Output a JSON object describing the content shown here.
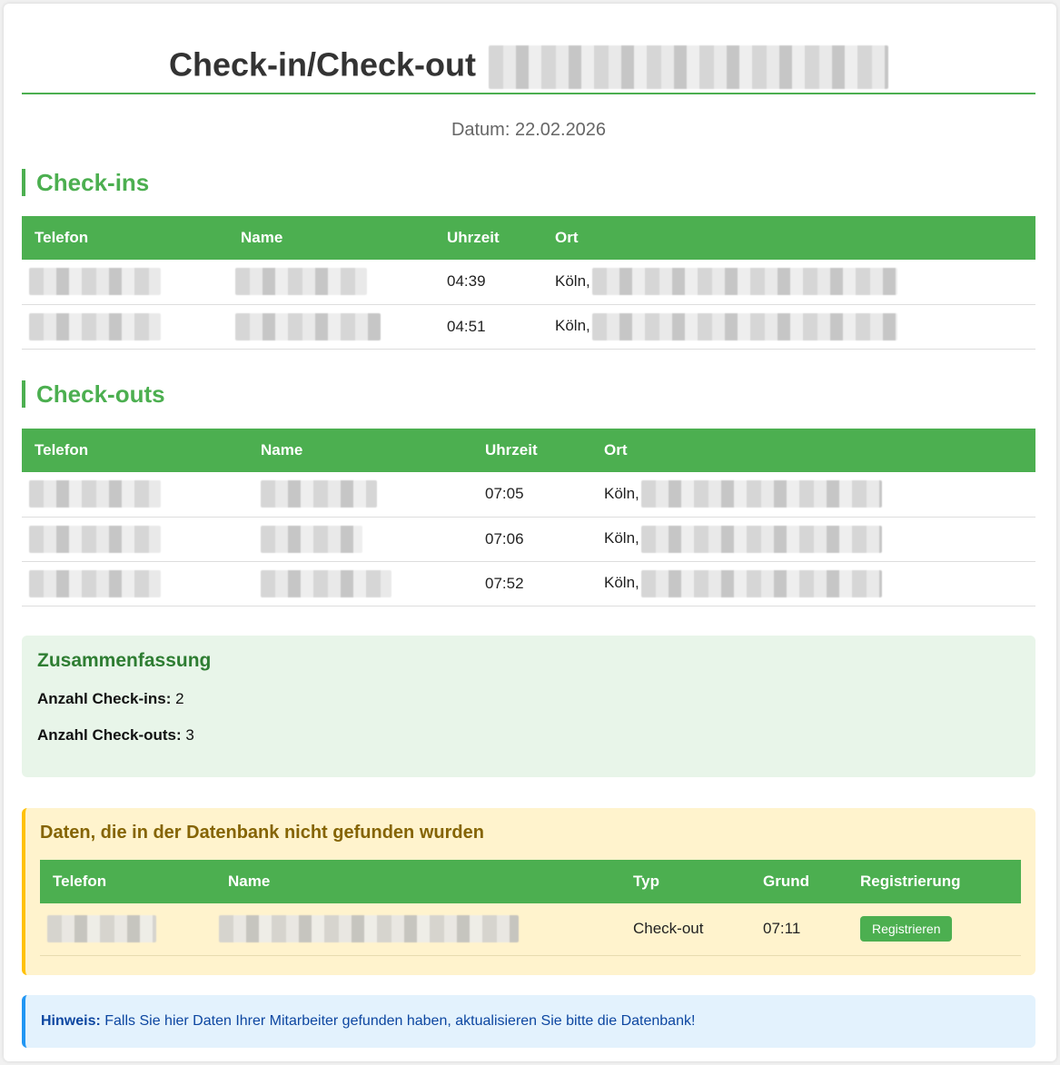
{
  "header": {
    "title": "Check-in/Check-out",
    "date_label": "Datum: 22.02.2026"
  },
  "checkins": {
    "heading": "Check-ins",
    "columns": [
      "Telefon",
      "Name",
      "Uhrzeit",
      "Ort"
    ],
    "rows": [
      {
        "time": "04:39",
        "ort_prefix": "Köln,"
      },
      {
        "time": "04:51",
        "ort_prefix": "Köln,"
      }
    ]
  },
  "checkouts": {
    "heading": "Check-outs",
    "columns": [
      "Telefon",
      "Name",
      "Uhrzeit",
      "Ort"
    ],
    "rows": [
      {
        "time": "07:05",
        "ort_prefix": "Köln,"
      },
      {
        "time": "07:06",
        "ort_prefix": "Köln,"
      },
      {
        "time": "07:52",
        "ort_prefix": "Köln,"
      }
    ]
  },
  "summary": {
    "heading": "Zusammenfassung",
    "checkins_label": "Anzahl Check-ins:",
    "checkins_value": "2",
    "checkouts_label": "Anzahl Check-outs:",
    "checkouts_value": "3"
  },
  "missing": {
    "heading": "Daten, die in der Datenbank nicht gefunden wurden",
    "columns": [
      "Telefon",
      "Name",
      "Typ",
      "Grund",
      "Registrierung"
    ],
    "rows": [
      {
        "typ": "Check-out",
        "grund": "07:11",
        "button": "Registrieren"
      }
    ]
  },
  "hint": {
    "label": "Hinweis:",
    "text": "Falls Sie hier Daten Ihrer Mitarbeiter gefunden haben, aktualisieren Sie bitte die Datenbank!"
  },
  "colors": {
    "accent": "#4caf50",
    "summary_bg": "#e8f5e9",
    "warning_bg": "#fff3cd",
    "warning_border": "#ffc107",
    "info_bg": "#e3f2fd",
    "info_border": "#2196f3"
  }
}
